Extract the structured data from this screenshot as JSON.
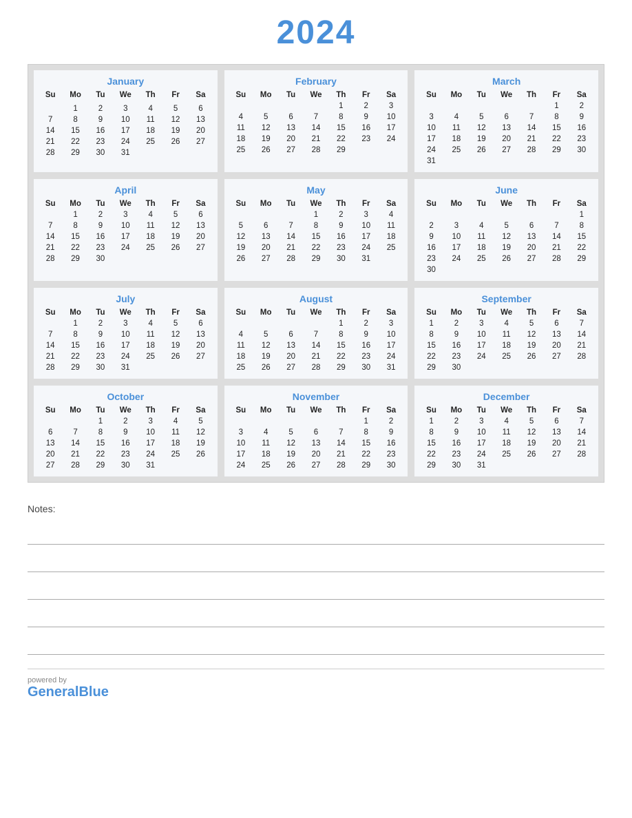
{
  "year": "2024",
  "brand": {
    "powered_by": "powered by",
    "name_regular": "General",
    "name_blue": "Blue"
  },
  "notes_label": "Notes:",
  "months": [
    {
      "name": "January",
      "days_header": [
        "Su",
        "Mo",
        "Tu",
        "We",
        "Th",
        "Fr",
        "Sa"
      ],
      "weeks": [
        [
          "",
          "",
          "",
          "",
          "",
          "",
          ""
        ],
        [
          "",
          "1",
          "2",
          "3",
          "4",
          "5",
          "6"
        ],
        [
          "7",
          "8",
          "9",
          "10",
          "11",
          "12",
          "13"
        ],
        [
          "14",
          "15",
          "16",
          "17",
          "18",
          "19",
          "20"
        ],
        [
          "21",
          "22",
          "23",
          "24",
          "25",
          "26",
          "27"
        ],
        [
          "28",
          "29",
          "30",
          "31",
          "",
          "",
          ""
        ]
      ]
    },
    {
      "name": "February",
      "days_header": [
        "Su",
        "Mo",
        "Tu",
        "We",
        "Th",
        "Fr",
        "Sa"
      ],
      "weeks": [
        [
          "",
          "",
          "",
          "",
          "1",
          "2",
          "3"
        ],
        [
          "4",
          "5",
          "6",
          "7",
          "8",
          "9",
          "10"
        ],
        [
          "11",
          "12",
          "13",
          "14",
          "15",
          "16",
          "17"
        ],
        [
          "18",
          "19",
          "20",
          "21",
          "22",
          "23",
          "24"
        ],
        [
          "25",
          "26",
          "27",
          "28",
          "29",
          "",
          ""
        ]
      ]
    },
    {
      "name": "March",
      "days_header": [
        "Su",
        "Mo",
        "Tu",
        "We",
        "Th",
        "Fr",
        "Sa"
      ],
      "weeks": [
        [
          "",
          "",
          "",
          "",
          "",
          "1",
          "2"
        ],
        [
          "3",
          "4",
          "5",
          "6",
          "7",
          "8",
          "9"
        ],
        [
          "10",
          "11",
          "12",
          "13",
          "14",
          "15",
          "16"
        ],
        [
          "17",
          "18",
          "19",
          "20",
          "21",
          "22",
          "23"
        ],
        [
          "24",
          "25",
          "26",
          "27",
          "28",
          "29",
          "30"
        ],
        [
          "31",
          "",
          "",
          "",
          "",
          "",
          ""
        ]
      ]
    },
    {
      "name": "April",
      "days_header": [
        "Su",
        "Mo",
        "Tu",
        "We",
        "Th",
        "Fr",
        "Sa"
      ],
      "weeks": [
        [
          "",
          "1",
          "2",
          "3",
          "4",
          "5",
          "6"
        ],
        [
          "7",
          "8",
          "9",
          "10",
          "11",
          "12",
          "13"
        ],
        [
          "14",
          "15",
          "16",
          "17",
          "18",
          "19",
          "20"
        ],
        [
          "21",
          "22",
          "23",
          "24",
          "25",
          "26",
          "27"
        ],
        [
          "28",
          "29",
          "30",
          "",
          "",
          "",
          ""
        ]
      ]
    },
    {
      "name": "May",
      "days_header": [
        "Su",
        "Mo",
        "Tu",
        "We",
        "Th",
        "Fr",
        "Sa"
      ],
      "weeks": [
        [
          "",
          "",
          "",
          "1",
          "2",
          "3",
          "4"
        ],
        [
          "5",
          "6",
          "7",
          "8",
          "9",
          "10",
          "11"
        ],
        [
          "12",
          "13",
          "14",
          "15",
          "16",
          "17",
          "18"
        ],
        [
          "19",
          "20",
          "21",
          "22",
          "23",
          "24",
          "25"
        ],
        [
          "26",
          "27",
          "28",
          "29",
          "30",
          "31",
          ""
        ]
      ]
    },
    {
      "name": "June",
      "days_header": [
        "Su",
        "Mo",
        "Tu",
        "We",
        "Th",
        "Fr",
        "Sa"
      ],
      "weeks": [
        [
          "",
          "",
          "",
          "",
          "",
          "",
          "1"
        ],
        [
          "2",
          "3",
          "4",
          "5",
          "6",
          "7",
          "8"
        ],
        [
          "9",
          "10",
          "11",
          "12",
          "13",
          "14",
          "15"
        ],
        [
          "16",
          "17",
          "18",
          "19",
          "20",
          "21",
          "22"
        ],
        [
          "23",
          "24",
          "25",
          "26",
          "27",
          "28",
          "29"
        ],
        [
          "30",
          "",
          "",
          "",
          "",
          "",
          ""
        ]
      ]
    },
    {
      "name": "July",
      "days_header": [
        "Su",
        "Mo",
        "Tu",
        "We",
        "Th",
        "Fr",
        "Sa"
      ],
      "weeks": [
        [
          "",
          "1",
          "2",
          "3",
          "4",
          "5",
          "6"
        ],
        [
          "7",
          "8",
          "9",
          "10",
          "11",
          "12",
          "13"
        ],
        [
          "14",
          "15",
          "16",
          "17",
          "18",
          "19",
          "20"
        ],
        [
          "21",
          "22",
          "23",
          "24",
          "25",
          "26",
          "27"
        ],
        [
          "28",
          "29",
          "30",
          "31",
          "",
          "",
          ""
        ]
      ]
    },
    {
      "name": "August",
      "days_header": [
        "Su",
        "Mo",
        "Tu",
        "We",
        "Th",
        "Fr",
        "Sa"
      ],
      "weeks": [
        [
          "",
          "",
          "",
          "",
          "1",
          "2",
          "3"
        ],
        [
          "4",
          "5",
          "6",
          "7",
          "8",
          "9",
          "10"
        ],
        [
          "11",
          "12",
          "13",
          "14",
          "15",
          "16",
          "17"
        ],
        [
          "18",
          "19",
          "20",
          "21",
          "22",
          "23",
          "24"
        ],
        [
          "25",
          "26",
          "27",
          "28",
          "29",
          "30",
          "31"
        ]
      ]
    },
    {
      "name": "September",
      "days_header": [
        "Su",
        "Mo",
        "Tu",
        "We",
        "Th",
        "Fr",
        "Sa"
      ],
      "weeks": [
        [
          "1",
          "2",
          "3",
          "4",
          "5",
          "6",
          "7"
        ],
        [
          "8",
          "9",
          "10",
          "11",
          "12",
          "13",
          "14"
        ],
        [
          "15",
          "16",
          "17",
          "18",
          "19",
          "20",
          "21"
        ],
        [
          "22",
          "23",
          "24",
          "25",
          "26",
          "27",
          "28"
        ],
        [
          "29",
          "30",
          "",
          "",
          "",
          "",
          ""
        ]
      ]
    },
    {
      "name": "October",
      "days_header": [
        "Su",
        "Mo",
        "Tu",
        "We",
        "Th",
        "Fr",
        "Sa"
      ],
      "weeks": [
        [
          "",
          "",
          "1",
          "2",
          "3",
          "4",
          "5"
        ],
        [
          "6",
          "7",
          "8",
          "9",
          "10",
          "11",
          "12"
        ],
        [
          "13",
          "14",
          "15",
          "16",
          "17",
          "18",
          "19"
        ],
        [
          "20",
          "21",
          "22",
          "23",
          "24",
          "25",
          "26"
        ],
        [
          "27",
          "28",
          "29",
          "30",
          "31",
          "",
          ""
        ]
      ]
    },
    {
      "name": "November",
      "days_header": [
        "Su",
        "Mo",
        "Tu",
        "We",
        "Th",
        "Fr",
        "Sa"
      ],
      "weeks": [
        [
          "",
          "",
          "",
          "",
          "",
          "1",
          "2"
        ],
        [
          "3",
          "4",
          "5",
          "6",
          "7",
          "8",
          "9"
        ],
        [
          "10",
          "11",
          "12",
          "13",
          "14",
          "15",
          "16"
        ],
        [
          "17",
          "18",
          "19",
          "20",
          "21",
          "22",
          "23"
        ],
        [
          "24",
          "25",
          "26",
          "27",
          "28",
          "29",
          "30"
        ]
      ]
    },
    {
      "name": "December",
      "days_header": [
        "Su",
        "Mo",
        "Tu",
        "We",
        "Th",
        "Fr",
        "Sa"
      ],
      "weeks": [
        [
          "1",
          "2",
          "3",
          "4",
          "5",
          "6",
          "7"
        ],
        [
          "8",
          "9",
          "10",
          "11",
          "12",
          "13",
          "14"
        ],
        [
          "15",
          "16",
          "17",
          "18",
          "19",
          "20",
          "21"
        ],
        [
          "22",
          "23",
          "24",
          "25",
          "26",
          "27",
          "28"
        ],
        [
          "29",
          "30",
          "31",
          "",
          "",
          "",
          ""
        ]
      ]
    }
  ]
}
